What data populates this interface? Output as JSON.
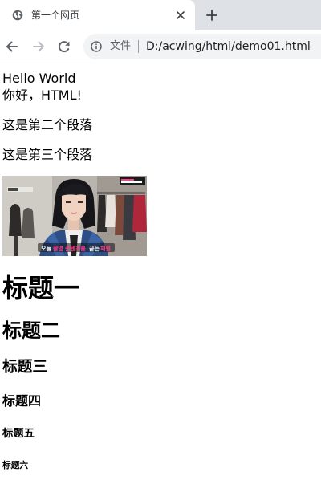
{
  "browser": {
    "tab": {
      "title": "第一个网页",
      "favicon_icon": "globe-icon",
      "close_icon": "close-icon"
    },
    "new_tab_icon": "plus-icon",
    "toolbar": {
      "back_icon": "arrow-left-icon",
      "forward_icon": "arrow-right-icon",
      "reload_icon": "reload-icon",
      "info_icon": "info-icon",
      "security_label": "文件",
      "url": "D:/acwing/html/demo01.html"
    }
  },
  "page": {
    "line1": "Hello World",
    "line2": "你好，HTML!",
    "paragraph2": "这是第二个段落",
    "paragraph3": "这是第三个段落",
    "image_caption_words": [
      "오늘",
      "촬영",
      "콘텐츠를",
      "끝는",
      "재원"
    ],
    "headings": {
      "h1": "标题一",
      "h2": "标题二",
      "h3": "标题三",
      "h4": "标题四",
      "h5": "标题五",
      "h6": "标题六"
    }
  },
  "colors": {
    "tabstrip_bg": "#dee1e6",
    "omnibox_bg": "#f1f3f4",
    "icon_gray": "#5f6368",
    "disabled_gray": "#9aa0a6",
    "caption_pink": "#ff3c8f"
  }
}
